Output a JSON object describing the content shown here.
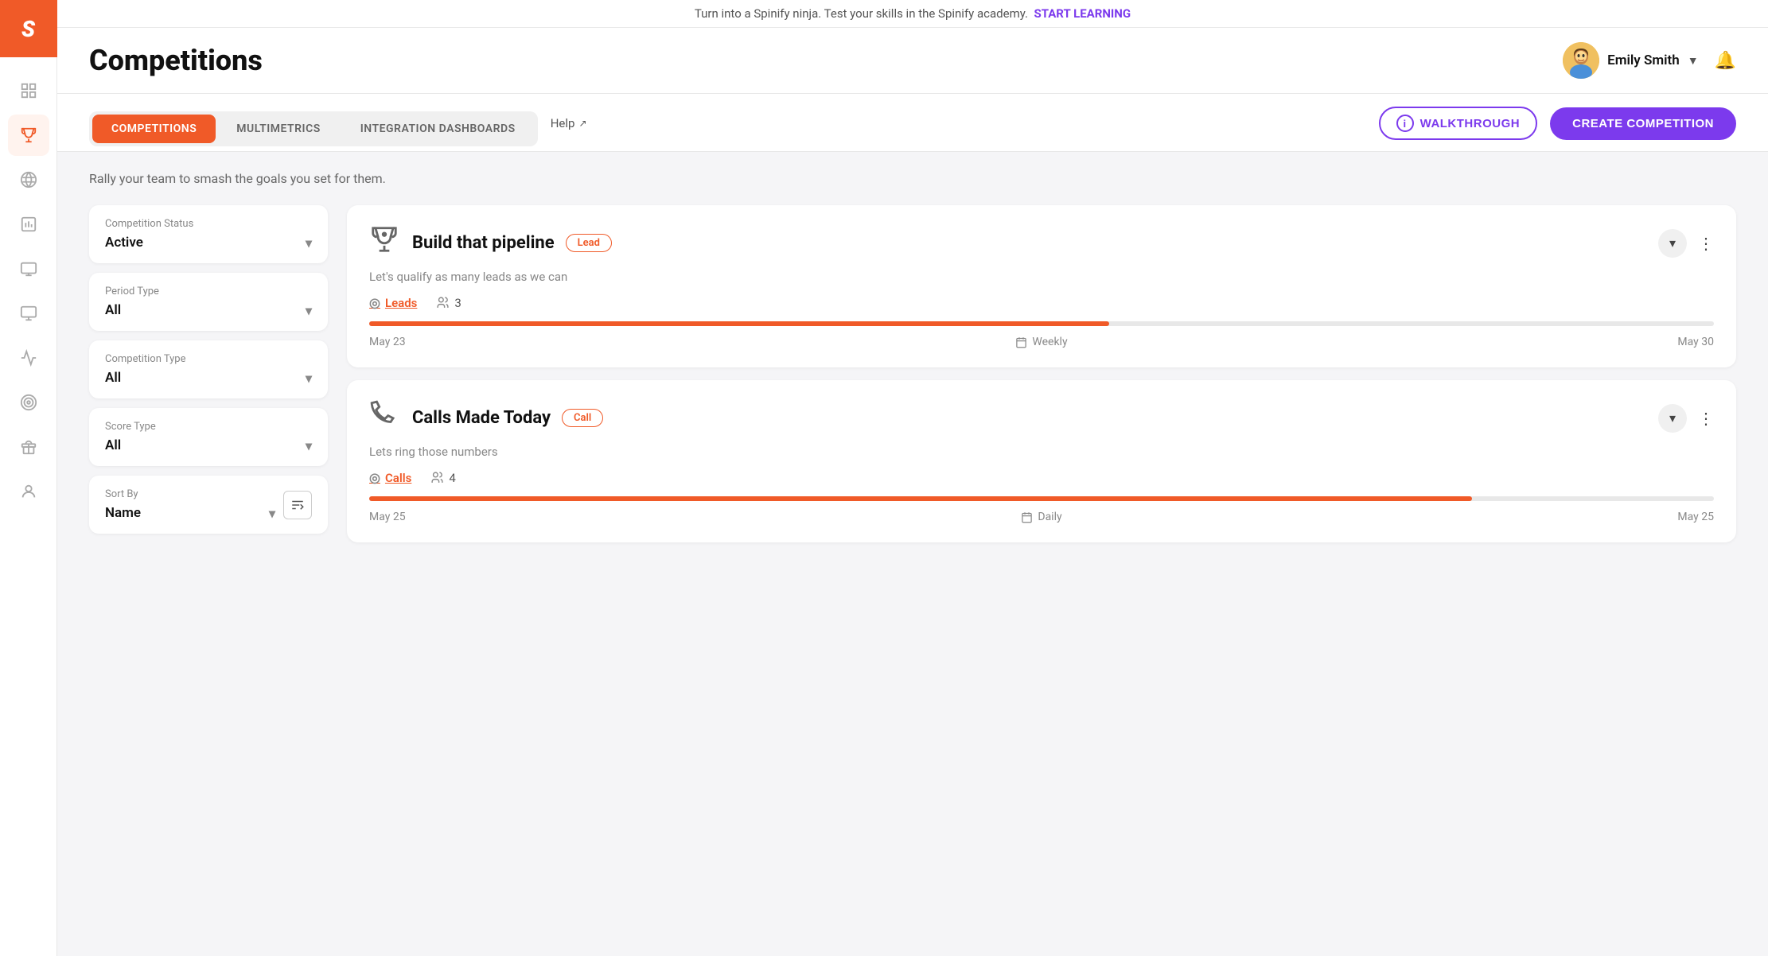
{
  "app": {
    "logo": "S"
  },
  "banner": {
    "text": "Turn into a Spinify ninja. Test your skills in the Spinify academy.",
    "link_text": "START LEARNING"
  },
  "header": {
    "title": "Competitions",
    "user": {
      "name": "Emily Smith",
      "avatar_emoji": "👩"
    }
  },
  "tabs": {
    "items": [
      {
        "id": "competitions",
        "label": "COMPETITIONS",
        "active": true
      },
      {
        "id": "multimetrics",
        "label": "MULTIMETRICS",
        "active": false
      },
      {
        "id": "integration-dashboards",
        "label": "INTEGRATION DASHBOARDS",
        "active": false
      }
    ],
    "help_label": "Help",
    "walkthrough_label": "WALKTHROUGH",
    "create_label": "CREATE COMPETITION"
  },
  "page": {
    "subtitle": "Rally your team to smash the goals you set for them."
  },
  "filters": {
    "competition_status": {
      "label": "Competition Status",
      "value": "Active"
    },
    "period_type": {
      "label": "Period Type",
      "value": "All"
    },
    "competition_type": {
      "label": "Competition Type",
      "value": "All"
    },
    "score_type": {
      "label": "Score Type",
      "value": "All"
    },
    "sort_by": {
      "label": "Sort By",
      "value": "Name"
    }
  },
  "competitions": [
    {
      "id": "build-pipeline",
      "icon": "🏆",
      "title": "Build that pipeline",
      "badge": "Lead",
      "description": "Let's qualify as many leads as we can",
      "metric": "Leads",
      "participants": 3,
      "progress": 55,
      "date_start": "May 23",
      "period": "Weekly",
      "date_end": "May 30"
    },
    {
      "id": "calls-made-today",
      "icon": "👟",
      "title": "Calls Made Today",
      "badge": "Call",
      "description": "Lets ring those numbers",
      "metric": "Calls",
      "participants": 4,
      "progress": 82,
      "date_start": "May 25",
      "period": "Daily",
      "date_end": "May 25"
    }
  ],
  "sidebar": {
    "items": [
      {
        "id": "dashboard",
        "icon": "📊"
      },
      {
        "id": "competitions",
        "icon": "🏆",
        "active": true
      },
      {
        "id": "megaphone",
        "icon": "📢"
      },
      {
        "id": "reports",
        "icon": "📋"
      },
      {
        "id": "display",
        "icon": "▭"
      },
      {
        "id": "monitor",
        "icon": "🖥"
      },
      {
        "id": "analytics",
        "icon": "📈"
      },
      {
        "id": "goals",
        "icon": "🎯"
      },
      {
        "id": "gifts",
        "icon": "🎁"
      },
      {
        "id": "users",
        "icon": "👤"
      }
    ]
  }
}
